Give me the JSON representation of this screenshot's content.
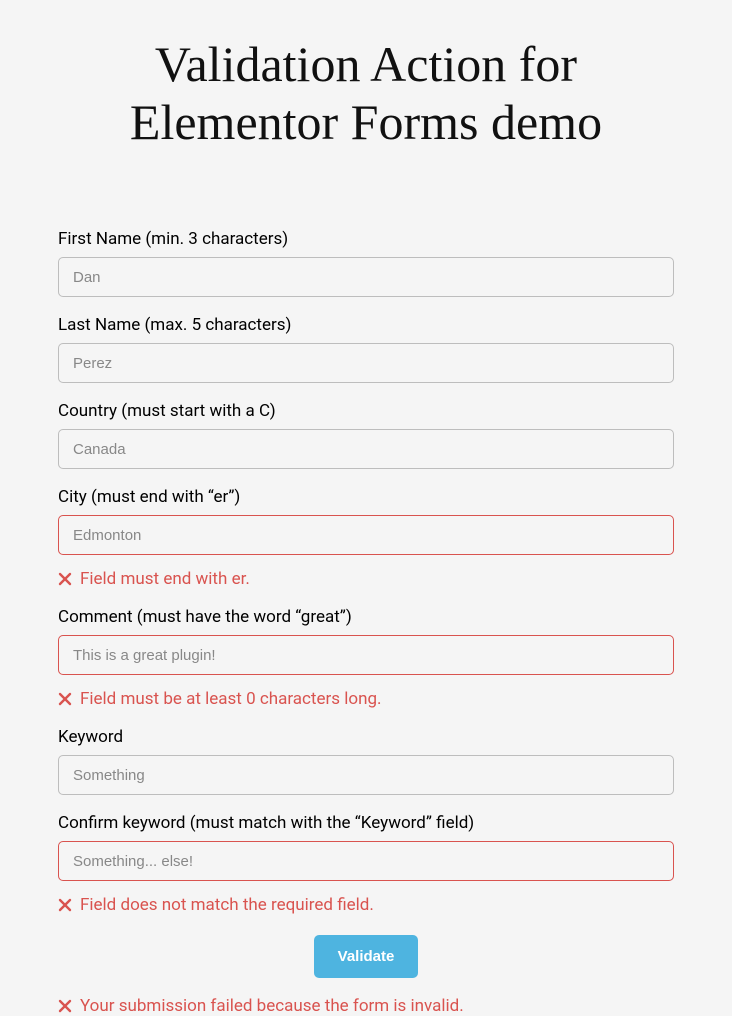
{
  "title": "Validation Action for Elementor Forms demo",
  "fields": {
    "first_name": {
      "label": "First Name (min. 3 characters)",
      "value": "Dan"
    },
    "last_name": {
      "label": "Last Name (max. 5 characters)",
      "value": "Perez"
    },
    "country": {
      "label": "Country (must start with a C)",
      "value": "Canada"
    },
    "city": {
      "label": "City (must end with “er”)",
      "value": "Edmonton",
      "error": "Field must end with er."
    },
    "comment": {
      "label": "Comment (must have the word “great”)",
      "value": "This is a great plugin!",
      "error": "Field must be at least 0 characters long."
    },
    "keyword": {
      "label": "Keyword",
      "value": "Something"
    },
    "confirm_keyword": {
      "label": "Confirm keyword (must match with the “Keyword” field)",
      "value": "Something... else!",
      "error": "Field does not match the required field."
    }
  },
  "button": "Validate",
  "form_error": "Your submission failed because the form is invalid."
}
